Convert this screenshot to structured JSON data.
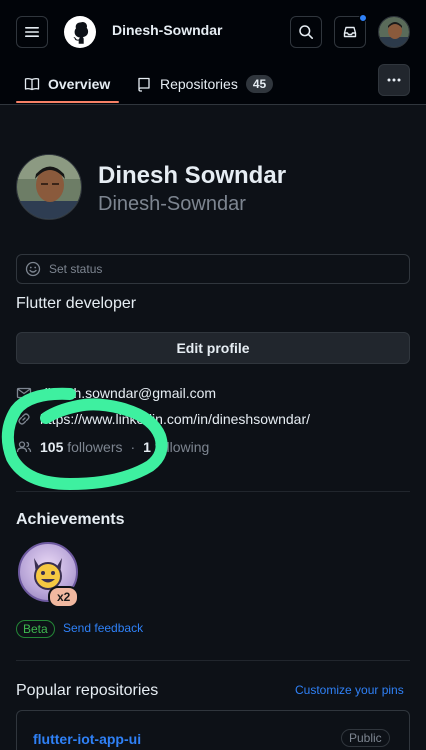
{
  "header": {
    "username": "Dinesh-Sowndar",
    "notification_dot": true
  },
  "tabs": [
    {
      "label": "Overview",
      "active": true
    },
    {
      "label": "Repositories",
      "count": "45"
    }
  ],
  "profile": {
    "full_name": "Dinesh Sowndar",
    "login": "Dinesh-Sowndar",
    "status_label": "Set status",
    "bio": "Flutter developer",
    "edit_label": "Edit profile",
    "email": "dinesh.sowndar@gmail.com",
    "link": "https://www.linkedin.com/in/dineshsowndar/",
    "followers_count": "105",
    "followers_label": "followers",
    "separator": "·",
    "following_count": "1",
    "following_label": "following"
  },
  "achievements": {
    "title": "Achievements",
    "badge_multiplier": "x2",
    "beta_label": "Beta",
    "feedback_label": "Send feedback"
  },
  "popular": {
    "title": "Popular repositories",
    "customize_label": "Customize your pins",
    "repos": [
      {
        "name": "flutter-iot-app-ui",
        "visibility": "Public"
      }
    ]
  },
  "colors": {
    "background": "#0d1117",
    "accent_link": "#2f81f7",
    "tab_underline": "#f78166",
    "annotation_scribble": "#3ef0a0"
  }
}
